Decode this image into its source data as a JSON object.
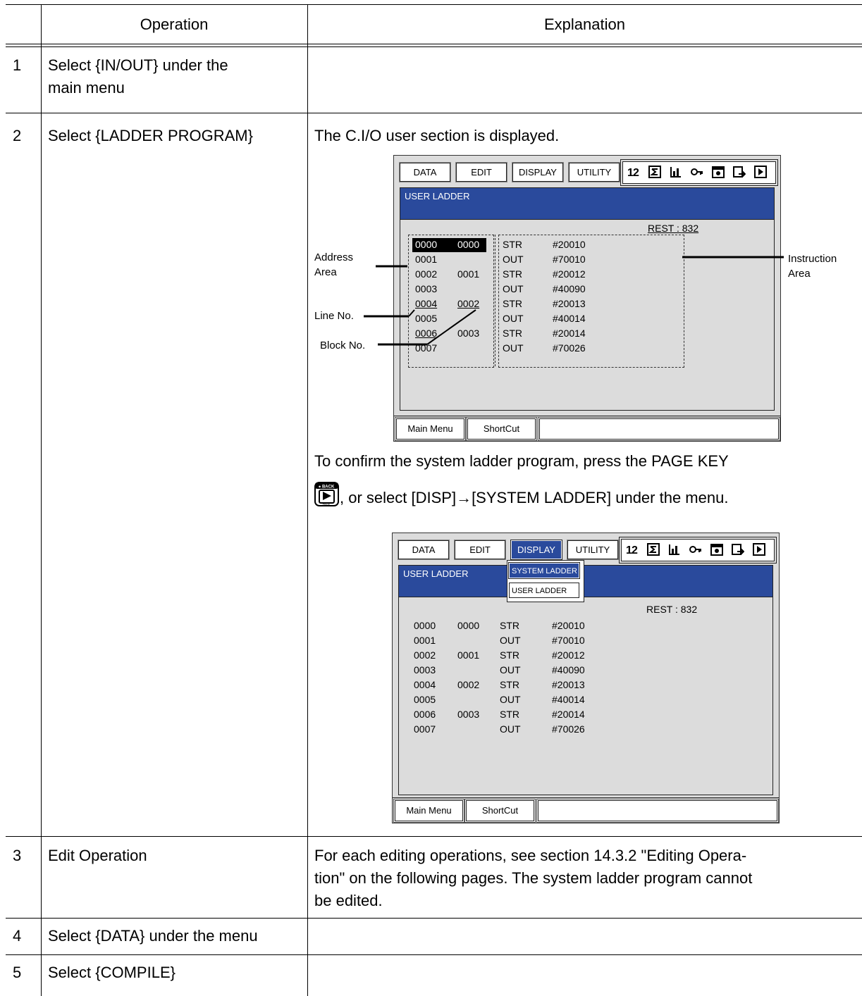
{
  "table": {
    "headers": {
      "operation": "Operation",
      "explanation": "Explanation"
    },
    "rows": [
      {
        "num": "1",
        "operation_lines": [
          "Select {IN/OUT} under the",
          "main menu"
        ],
        "explanation_lines": []
      },
      {
        "num": "2",
        "operation_lines": [
          "Select {LADDER PROGRAM}"
        ],
        "explanation_lines": [
          "The C.I/O user section is displayed."
        ]
      },
      {
        "num": "3",
        "operation_lines": [
          "Edit Operation"
        ],
        "explanation_lines": [
          "For each editing operations, see section 14.3.2 \"Editing Opera-",
          "tion\" on the following pages.  The system ladder program cannot",
          "be edited."
        ]
      },
      {
        "num": "4",
        "operation_lines": [
          "Select {DATA} under the menu"
        ],
        "explanation_lines": []
      },
      {
        "num": "5",
        "operation_lines": [
          "Select {COMPILE}"
        ],
        "explanation_lines": []
      }
    ],
    "row2_mid_text": {
      "line1": "To confirm the system ladder program, press the PAGE KEY",
      "line2_before": ", or select [DISP]",
      "arrow": "→",
      "line2_after": "[SYSTEM LADDER] under the menu."
    },
    "page_key": {
      "top": "BACK",
      "bottom": "PAGE",
      "icon": "page-key-icon"
    }
  },
  "screen1": {
    "menu": [
      "DATA",
      "EDIT",
      "DISPLAY",
      "UTILITY"
    ],
    "title": "USER LADDER",
    "rest": "REST : 832",
    "rows": [
      [
        "0000",
        "0000",
        "STR",
        "#20010"
      ],
      [
        "0001",
        "",
        "OUT",
        "#70010"
      ],
      [
        "0002",
        "0001",
        "STR",
        "#20012"
      ],
      [
        "0003",
        "",
        "OUT",
        "#40090"
      ],
      [
        "0004",
        "0002",
        "STR",
        "#20013"
      ],
      [
        "0005",
        "",
        "OUT",
        "#40014"
      ],
      [
        "0006",
        "0003",
        "STR",
        "#20014"
      ],
      [
        "0007",
        "",
        "OUT",
        "#70026"
      ]
    ],
    "callouts": {
      "address_area": [
        "Address",
        "Area"
      ],
      "instruction_area": [
        "Instruction",
        "Area"
      ],
      "line_no": "Line No.",
      "block_no": "Block No."
    },
    "bottom": [
      "Main Menu",
      "ShortCut"
    ]
  },
  "screen2": {
    "menu": [
      "DATA",
      "EDIT",
      "DISPLAY",
      "UTILITY"
    ],
    "title": "USER LADDER",
    "popup": [
      "SYSTEM LADDER",
      "USER LADDER"
    ],
    "rest": "REST : 832",
    "rows": [
      [
        "0000",
        "0000",
        "STR",
        "#20010"
      ],
      [
        "0001",
        "",
        "OUT",
        "#70010"
      ],
      [
        "0002",
        "0001",
        "STR",
        "#20012"
      ],
      [
        "0003",
        "",
        "OUT",
        "#40090"
      ],
      [
        "0004",
        "0002",
        "STR",
        "#20013"
      ],
      [
        "0005",
        "",
        "OUT",
        "#40014"
      ],
      [
        "0006",
        "0003",
        "STR",
        "#20014"
      ],
      [
        "0007",
        "",
        "OUT",
        "#70026"
      ]
    ],
    "bottom": [
      "Main Menu",
      "ShortCut"
    ]
  },
  "icons": [
    "number-icon",
    "sigma-icon",
    "chart-icon",
    "key-icon",
    "calendar-icon",
    "export-icon",
    "play-icon"
  ]
}
